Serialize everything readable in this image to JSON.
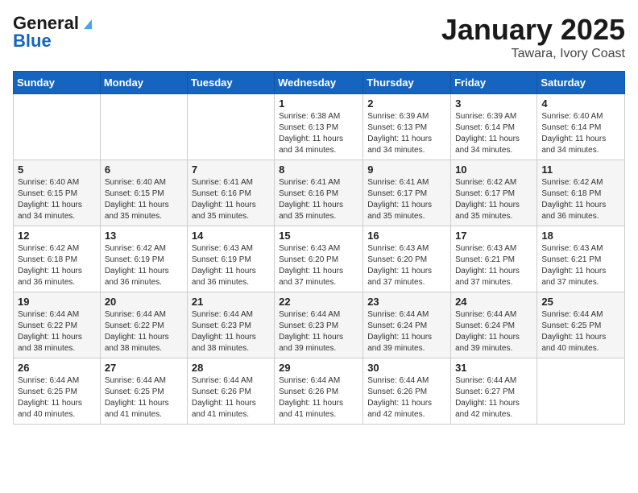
{
  "header": {
    "logo_line1": "General",
    "logo_line2": "Blue",
    "month": "January 2025",
    "location": "Tawara, Ivory Coast"
  },
  "weekdays": [
    "Sunday",
    "Monday",
    "Tuesday",
    "Wednesday",
    "Thursday",
    "Friday",
    "Saturday"
  ],
  "weeks": [
    [
      {
        "day": "",
        "sunrise": "",
        "sunset": "",
        "daylight": ""
      },
      {
        "day": "",
        "sunrise": "",
        "sunset": "",
        "daylight": ""
      },
      {
        "day": "",
        "sunrise": "",
        "sunset": "",
        "daylight": ""
      },
      {
        "day": "1",
        "sunrise": "Sunrise: 6:38 AM",
        "sunset": "Sunset: 6:13 PM",
        "daylight": "Daylight: 11 hours and 34 minutes."
      },
      {
        "day": "2",
        "sunrise": "Sunrise: 6:39 AM",
        "sunset": "Sunset: 6:13 PM",
        "daylight": "Daylight: 11 hours and 34 minutes."
      },
      {
        "day": "3",
        "sunrise": "Sunrise: 6:39 AM",
        "sunset": "Sunset: 6:14 PM",
        "daylight": "Daylight: 11 hours and 34 minutes."
      },
      {
        "day": "4",
        "sunrise": "Sunrise: 6:40 AM",
        "sunset": "Sunset: 6:14 PM",
        "daylight": "Daylight: 11 hours and 34 minutes."
      }
    ],
    [
      {
        "day": "5",
        "sunrise": "Sunrise: 6:40 AM",
        "sunset": "Sunset: 6:15 PM",
        "daylight": "Daylight: 11 hours and 34 minutes."
      },
      {
        "day": "6",
        "sunrise": "Sunrise: 6:40 AM",
        "sunset": "Sunset: 6:15 PM",
        "daylight": "Daylight: 11 hours and 35 minutes."
      },
      {
        "day": "7",
        "sunrise": "Sunrise: 6:41 AM",
        "sunset": "Sunset: 6:16 PM",
        "daylight": "Daylight: 11 hours and 35 minutes."
      },
      {
        "day": "8",
        "sunrise": "Sunrise: 6:41 AM",
        "sunset": "Sunset: 6:16 PM",
        "daylight": "Daylight: 11 hours and 35 minutes."
      },
      {
        "day": "9",
        "sunrise": "Sunrise: 6:41 AM",
        "sunset": "Sunset: 6:17 PM",
        "daylight": "Daylight: 11 hours and 35 minutes."
      },
      {
        "day": "10",
        "sunrise": "Sunrise: 6:42 AM",
        "sunset": "Sunset: 6:17 PM",
        "daylight": "Daylight: 11 hours and 35 minutes."
      },
      {
        "day": "11",
        "sunrise": "Sunrise: 6:42 AM",
        "sunset": "Sunset: 6:18 PM",
        "daylight": "Daylight: 11 hours and 36 minutes."
      }
    ],
    [
      {
        "day": "12",
        "sunrise": "Sunrise: 6:42 AM",
        "sunset": "Sunset: 6:18 PM",
        "daylight": "Daylight: 11 hours and 36 minutes."
      },
      {
        "day": "13",
        "sunrise": "Sunrise: 6:42 AM",
        "sunset": "Sunset: 6:19 PM",
        "daylight": "Daylight: 11 hours and 36 minutes."
      },
      {
        "day": "14",
        "sunrise": "Sunrise: 6:43 AM",
        "sunset": "Sunset: 6:19 PM",
        "daylight": "Daylight: 11 hours and 36 minutes."
      },
      {
        "day": "15",
        "sunrise": "Sunrise: 6:43 AM",
        "sunset": "Sunset: 6:20 PM",
        "daylight": "Daylight: 11 hours and 37 minutes."
      },
      {
        "day": "16",
        "sunrise": "Sunrise: 6:43 AM",
        "sunset": "Sunset: 6:20 PM",
        "daylight": "Daylight: 11 hours and 37 minutes."
      },
      {
        "day": "17",
        "sunrise": "Sunrise: 6:43 AM",
        "sunset": "Sunset: 6:21 PM",
        "daylight": "Daylight: 11 hours and 37 minutes."
      },
      {
        "day": "18",
        "sunrise": "Sunrise: 6:43 AM",
        "sunset": "Sunset: 6:21 PM",
        "daylight": "Daylight: 11 hours and 37 minutes."
      }
    ],
    [
      {
        "day": "19",
        "sunrise": "Sunrise: 6:44 AM",
        "sunset": "Sunset: 6:22 PM",
        "daylight": "Daylight: 11 hours and 38 minutes."
      },
      {
        "day": "20",
        "sunrise": "Sunrise: 6:44 AM",
        "sunset": "Sunset: 6:22 PM",
        "daylight": "Daylight: 11 hours and 38 minutes."
      },
      {
        "day": "21",
        "sunrise": "Sunrise: 6:44 AM",
        "sunset": "Sunset: 6:23 PM",
        "daylight": "Daylight: 11 hours and 38 minutes."
      },
      {
        "day": "22",
        "sunrise": "Sunrise: 6:44 AM",
        "sunset": "Sunset: 6:23 PM",
        "daylight": "Daylight: 11 hours and 39 minutes."
      },
      {
        "day": "23",
        "sunrise": "Sunrise: 6:44 AM",
        "sunset": "Sunset: 6:24 PM",
        "daylight": "Daylight: 11 hours and 39 minutes."
      },
      {
        "day": "24",
        "sunrise": "Sunrise: 6:44 AM",
        "sunset": "Sunset: 6:24 PM",
        "daylight": "Daylight: 11 hours and 39 minutes."
      },
      {
        "day": "25",
        "sunrise": "Sunrise: 6:44 AM",
        "sunset": "Sunset: 6:25 PM",
        "daylight": "Daylight: 11 hours and 40 minutes."
      }
    ],
    [
      {
        "day": "26",
        "sunrise": "Sunrise: 6:44 AM",
        "sunset": "Sunset: 6:25 PM",
        "daylight": "Daylight: 11 hours and 40 minutes."
      },
      {
        "day": "27",
        "sunrise": "Sunrise: 6:44 AM",
        "sunset": "Sunset: 6:25 PM",
        "daylight": "Daylight: 11 hours and 41 minutes."
      },
      {
        "day": "28",
        "sunrise": "Sunrise: 6:44 AM",
        "sunset": "Sunset: 6:26 PM",
        "daylight": "Daylight: 11 hours and 41 minutes."
      },
      {
        "day": "29",
        "sunrise": "Sunrise: 6:44 AM",
        "sunset": "Sunset: 6:26 PM",
        "daylight": "Daylight: 11 hours and 41 minutes."
      },
      {
        "day": "30",
        "sunrise": "Sunrise: 6:44 AM",
        "sunset": "Sunset: 6:26 PM",
        "daylight": "Daylight: 11 hours and 42 minutes."
      },
      {
        "day": "31",
        "sunrise": "Sunrise: 6:44 AM",
        "sunset": "Sunset: 6:27 PM",
        "daylight": "Daylight: 11 hours and 42 minutes."
      },
      {
        "day": "",
        "sunrise": "",
        "sunset": "",
        "daylight": ""
      }
    ]
  ]
}
